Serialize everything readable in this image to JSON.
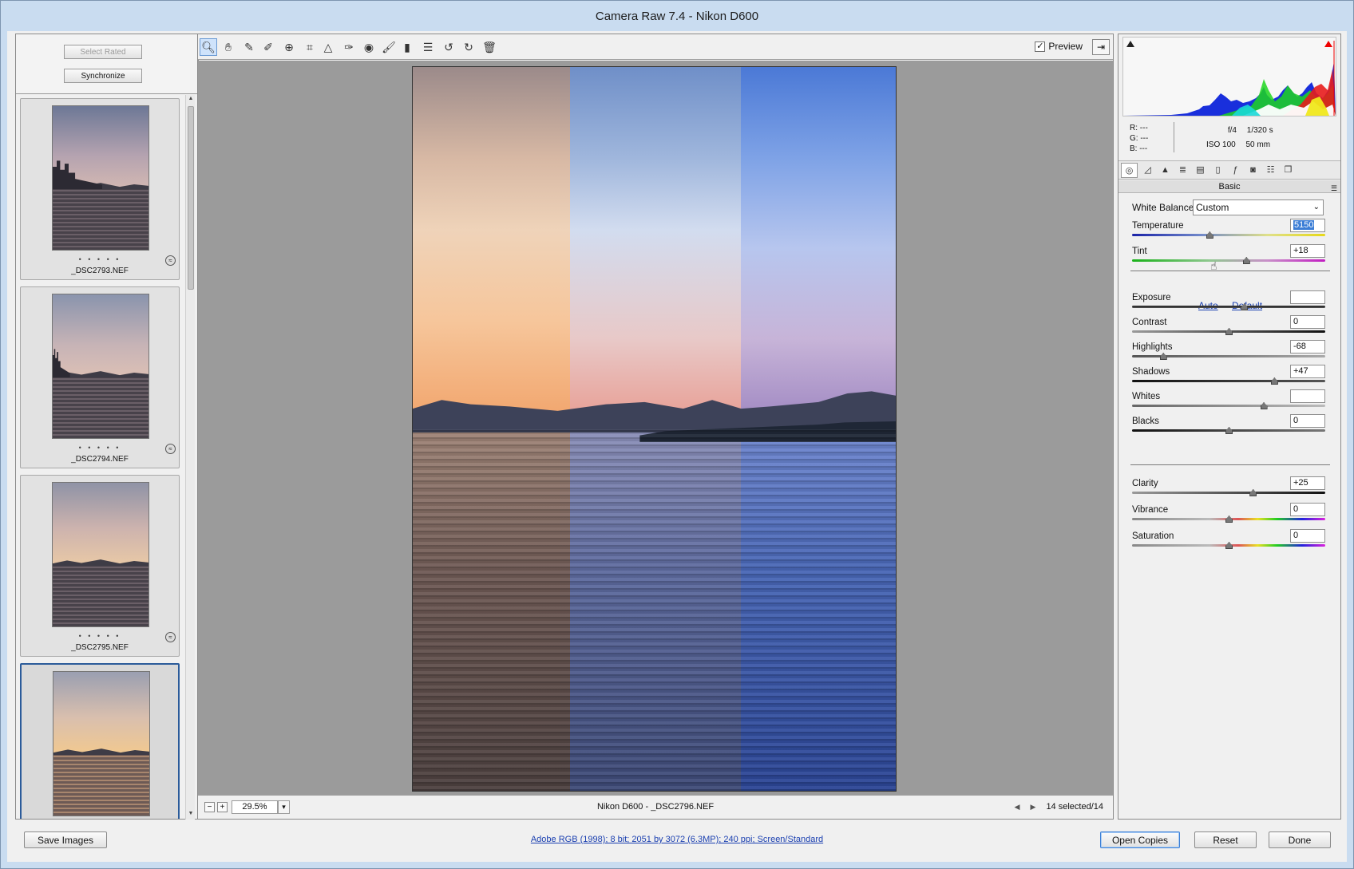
{
  "window": {
    "title": "Camera Raw 7.4  -  Nikon D600"
  },
  "filmstrip": {
    "select_rated": "Select Rated",
    "synchronize": "Synchronize",
    "items": [
      {
        "name": "_DSC2793.NEF",
        "stars": "• • • • •"
      },
      {
        "name": "_DSC2794.NEF",
        "stars": "• • • • •"
      },
      {
        "name": "_DSC2795.NEF",
        "stars": "• • • • •"
      },
      {
        "name": "",
        "stars": ""
      }
    ]
  },
  "toolbar": {
    "tools": [
      "zoom-tool",
      "hand-tool",
      "white-balance-tool",
      "color-sampler-tool",
      "targeted-adjustment-tool",
      "crop-tool",
      "straighten-tool",
      "spot-removal-tool",
      "red-eye-tool",
      "adjustment-brush",
      "graduated-filter",
      "preferences",
      "rotate-ccw",
      "rotate-cw",
      "delete"
    ],
    "preview_label": "Preview",
    "preview_checked": true
  },
  "status": {
    "zoom": "29.5%",
    "filename": "Nikon D600  -  _DSC2796.NEF",
    "selection": "14 selected/14"
  },
  "readout": {
    "r": "R:   ---",
    "g": "G:   ---",
    "b": "B:   ---",
    "aperture": "f/4",
    "shutter": "1/320 s",
    "iso": "ISO 100",
    "focal": "50 mm"
  },
  "panel": {
    "title": "Basic",
    "white_balance_label": "White Balance:",
    "white_balance_value": "Custom",
    "auto": "Auto",
    "default": "Default",
    "sliders": {
      "temperature": {
        "label": "Temperature",
        "value": "5150",
        "pos": 0.4
      },
      "tint": {
        "label": "Tint",
        "value": "+18",
        "pos": 0.59
      },
      "exposure": {
        "label": "Exposure",
        "value": "",
        "pos": 0.58
      },
      "contrast": {
        "label": "Contrast",
        "value": "0",
        "pos": 0.5
      },
      "highlights": {
        "label": "Highlights",
        "value": "-68",
        "pos": 0.16
      },
      "shadows": {
        "label": "Shadows",
        "value": "+47",
        "pos": 0.735
      },
      "whites": {
        "label": "Whites",
        "value": "",
        "pos": 0.68
      },
      "blacks": {
        "label": "Blacks",
        "value": "0",
        "pos": 0.5
      },
      "clarity": {
        "label": "Clarity",
        "value": "+25",
        "pos": 0.625
      },
      "vibrance": {
        "label": "Vibrance",
        "value": "0",
        "pos": 0.5
      },
      "saturation": {
        "label": "Saturation",
        "value": "0",
        "pos": 0.5
      }
    }
  },
  "bottom": {
    "save_images": "Save Images",
    "workflow": "Adobe RGB (1998); 8 bit; 2051 by 3072 (6.3MP); 240 ppi; Screen/Standard",
    "open_copies": "Open Copies",
    "reset": "Reset",
    "done": "Done"
  }
}
